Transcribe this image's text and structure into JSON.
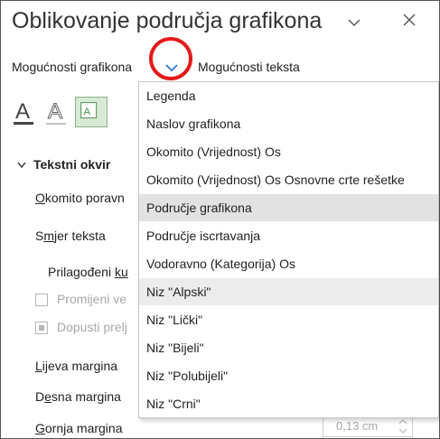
{
  "window": {
    "title": "Oblikovanje područja grafikona",
    "chevron_icon": "chevron-down-icon",
    "close_icon": "close-icon"
  },
  "options": {
    "chart_options_label": "Mogućnosti grafikona",
    "text_options_label": "Mogućnosti teksta"
  },
  "icons": [
    "text-fill-icon",
    "text-outline-icon",
    "text-effects-icon"
  ],
  "panel": {
    "section_title": "Tekstni okvir",
    "rows": [
      {
        "label": "Okomito poravn",
        "underline": "O"
      },
      {
        "label": "Smjer teksta",
        "underline": "m"
      },
      {
        "label": "Prilagođeni ku",
        "underline": "ku"
      },
      {
        "label": "Promijeni ve",
        "disabled": true
      },
      {
        "label": "Dopusti prelj",
        "disabled": true
      },
      {
        "label": "Lijeva margina",
        "underline": "L"
      },
      {
        "label": "Desna margina",
        "underline": "e"
      },
      {
        "label": "Gornja margina",
        "underline": "G"
      }
    ],
    "gornja_margina_value": "0,13 cm"
  },
  "dropdown": {
    "items": [
      "Legenda",
      "Naslov grafikona",
      "Okomito (Vrijednost) Os",
      "Okomito (Vrijednost) Os Osnovne crte rešetke",
      "Područje grafikona",
      "Područje iscrtavanja",
      "Vodoravno (Kategorija) Os",
      "Niz \"Alpski\"",
      "Niz \"Lički\"",
      "Niz \"Bijeli\"",
      "Niz \"Polubijeli\"",
      "Niz \"Crni\""
    ],
    "selected_index": 4,
    "hover_index": 7
  },
  "colors": {
    "highlight_circle": "#e31b1b",
    "chevron_blue": "#2b78d4",
    "selected_bg": "#e2e2e2"
  }
}
